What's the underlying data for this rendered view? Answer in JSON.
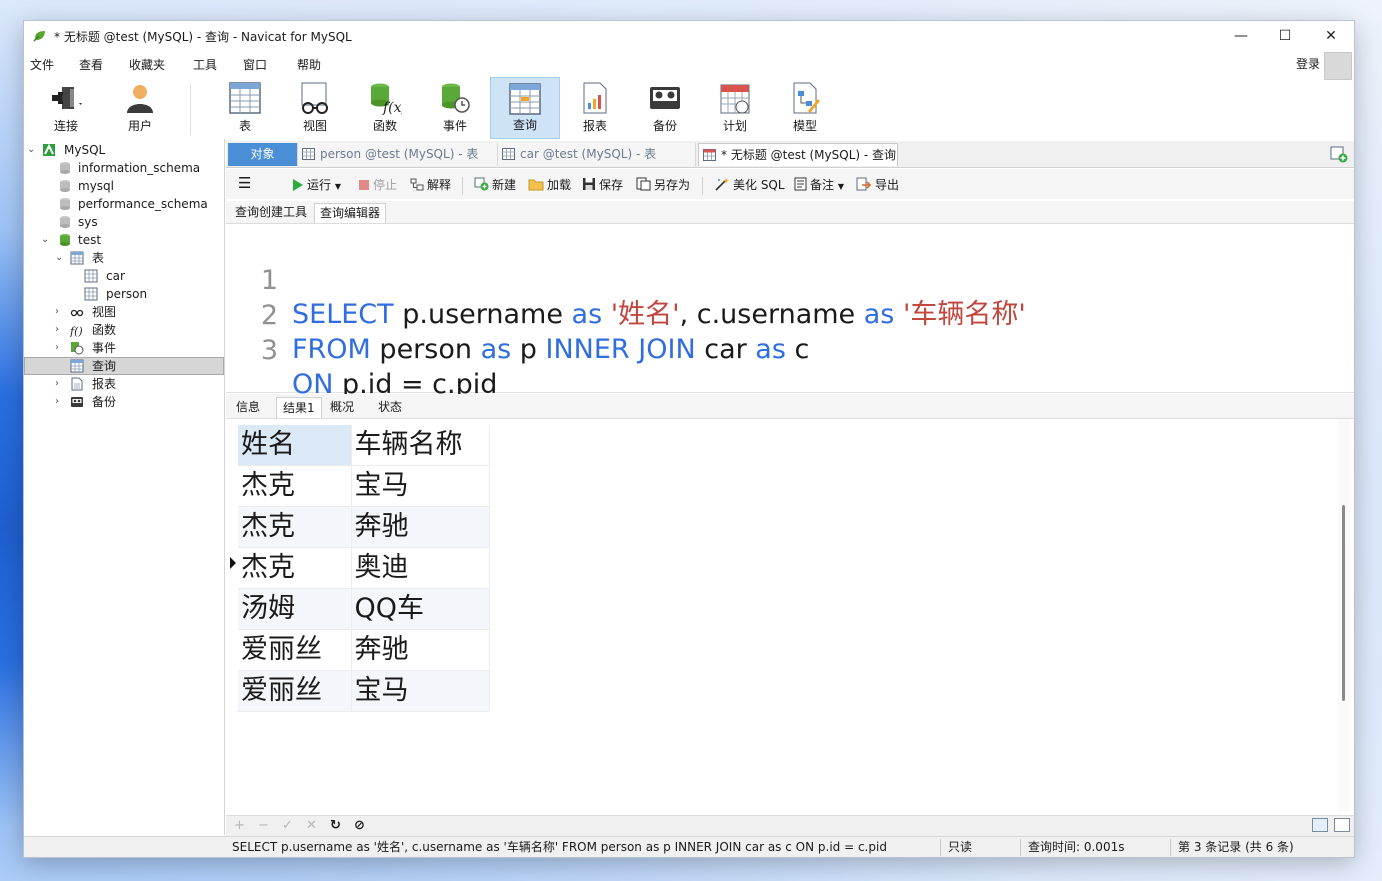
{
  "window": {
    "title": "* 无标题 @test (MySQL) - 查询 - Navicat for MySQL"
  },
  "menu": {
    "items": [
      "文件",
      "查看",
      "收藏夹",
      "工具",
      "窗口",
      "帮助"
    ],
    "login": "登录"
  },
  "toolbar": {
    "buttons": [
      {
        "label": "连接",
        "icon": "plug-icon"
      },
      {
        "label": "用户",
        "icon": "user-icon"
      },
      {
        "label": "表",
        "icon": "table-icon"
      },
      {
        "label": "视图",
        "icon": "view-glasses-icon"
      },
      {
        "label": "函数",
        "icon": "function-icon"
      },
      {
        "label": "事件",
        "icon": "event-clock-icon"
      },
      {
        "label": "查询",
        "icon": "query-icon",
        "active": true
      },
      {
        "label": "报表",
        "icon": "report-icon"
      },
      {
        "label": "备份",
        "icon": "backup-icon"
      },
      {
        "label": "计划",
        "icon": "calendar-icon"
      },
      {
        "label": "模型",
        "icon": "model-icon"
      }
    ]
  },
  "tree": {
    "connection": "MySQL",
    "databases": [
      "information_schema",
      "mysql",
      "performance_schema",
      "sys",
      "test"
    ],
    "test_children": {
      "tables_label": "表",
      "tables": [
        "car",
        "person"
      ],
      "views": "视图",
      "functions": "函数",
      "events": "事件",
      "queries": "查询",
      "reports": "报表",
      "backups": "备份"
    }
  },
  "tabs": {
    "objects": "对象",
    "items": [
      "person @test (MySQL) - 表",
      "car @test (MySQL) - 表",
      "* 无标题 @test (MySQL) - 查询"
    ]
  },
  "query_toolbar": {
    "run": "运行",
    "stop": "停止",
    "explain": "解释",
    "new": "新建",
    "load": "加载",
    "save": "保存",
    "save_as": "另存为",
    "beautify": "美化 SQL",
    "comment": "备注",
    "export": "导出"
  },
  "subtabs": {
    "builder": "查询创建工具",
    "editor": "查询编辑器"
  },
  "editor": {
    "line_numbers": [
      "1",
      "2",
      "3"
    ],
    "line1": {
      "kw1": "SELECT",
      "id1": " p.username ",
      "kw2": "as",
      "str1": " '姓名'",
      "id2": ", c.username ",
      "kw3": "as",
      "str2": " '车辆名称'"
    },
    "line2": {
      "kw1": "FROM",
      "id1": " person ",
      "kw2": "as",
      "id2": " p ",
      "kw3": "INNER JOIN",
      "id3": " car ",
      "kw4": "as",
      "id4": " c"
    },
    "line3": {
      "kw1": "ON",
      "id1": " p.id = c.pid"
    }
  },
  "result_tabs": [
    "信息",
    "结果1",
    "概况",
    "状态"
  ],
  "results": {
    "columns": [
      "姓名",
      "车辆名称"
    ],
    "rows": [
      [
        "杰克",
        "宝马"
      ],
      [
        "杰克",
        "奔驰"
      ],
      [
        "杰克",
        "奥迪"
      ],
      [
        "汤姆",
        "QQ车"
      ],
      [
        "爱丽丝",
        "奔驰"
      ],
      [
        "爱丽丝",
        "宝马"
      ]
    ]
  },
  "grid_toolbar": {
    "add": "+",
    "remove": "−",
    "apply": "✓",
    "discard": "✕",
    "refresh": "↻",
    "stop": "⊘"
  },
  "status": {
    "sql": "SELECT p.username as '姓名', c.username as '车辆名称' FROM person as p INNER JOIN car as c ON p.id = c.pid",
    "mode": "只读",
    "query_time": "查询时间: 0.001s",
    "record": "第 3 条记录 (共 6 条)"
  },
  "colors": {
    "keyword": "#2f6de0",
    "string": "#c0463e",
    "object_tab": "#4a8fd6",
    "active_tool": "#cfe3f7"
  }
}
